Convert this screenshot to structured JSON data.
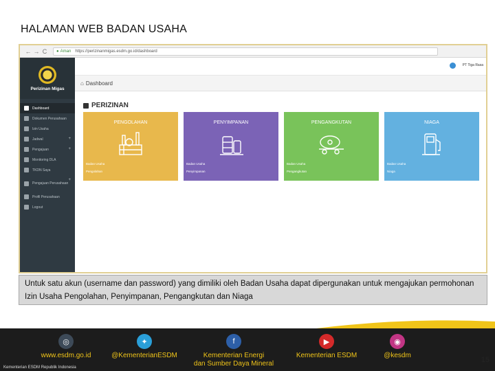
{
  "slide": {
    "title": "HALAMAN WEB BADAN USAHA",
    "caption": "Untuk satu akun (username dan password) yang dimiliki oleh Badan Usaha dapat dipergunakan untuk mengajukan permohonan Izin Usaha Pengolahan, Penyimpanan, Pengangkutan dan Niaga",
    "page_number": "15"
  },
  "browser": {
    "back": "←",
    "forward": "→",
    "reload": "C",
    "secure_label": "Aman",
    "url": "https://perizinanmigas.esdm.go.id/dashboard"
  },
  "app": {
    "brand": "Perizinan Migas",
    "user": "PT Tiga Rasa",
    "dashboard_title": "Dashboard",
    "section_title": "PERIZINAN"
  },
  "sidebar": {
    "items": [
      {
        "label": "Dashboard",
        "icon": "home-icon"
      },
      {
        "label": "Dokumen Perusahaan",
        "icon": "document-icon"
      },
      {
        "label": "Izin Usaha",
        "icon": "file-icon"
      },
      {
        "label": "Jadwal",
        "icon": "calendar-icon"
      },
      {
        "label": "Pengajuan",
        "icon": "send-icon"
      },
      {
        "label": "Monitoring DLA",
        "icon": "monitor-icon"
      },
      {
        "label": "TKDN Saya",
        "icon": "list-icon"
      },
      {
        "label": "Pengajuan Perusahaan",
        "icon": "building-icon"
      },
      {
        "label": "Profil Perusahaan",
        "icon": "profile-icon"
      },
      {
        "label": "Logout",
        "icon": "logout-icon"
      }
    ]
  },
  "cards": [
    {
      "title": "PENGOLAHAN",
      "line1": "Badan Usaha",
      "line2": "Pengolahan",
      "color": "#e8b84c",
      "icon": "refinery-icon"
    },
    {
      "title": "PENYIMPANAN",
      "line1": "Badan Usaha",
      "line2": "Penyimpanan",
      "color": "#7b63b6",
      "icon": "storage-tank-icon"
    },
    {
      "title": "PENGANGKUTAN",
      "line1": "Badan Usaha",
      "line2": "Pengangkutan",
      "color": "#79c35a",
      "icon": "tanker-truck-icon"
    },
    {
      "title": "NIAGA",
      "line1": "Badan Usaha",
      "line2": "Niaga",
      "color": "#63b1e0",
      "icon": "fuel-pump-icon"
    }
  ],
  "footer": {
    "website": "www.esdm.go.id",
    "twitter": "@KementerianESDM",
    "facebook_line1": "Kementerian Energi",
    "facebook_line2": "dan Sumber Daya Mineral",
    "youtube": "Kementerian ESDM",
    "instagram": "@kesdm",
    "org": "Kementerian ESDM Republik Indonesia"
  }
}
